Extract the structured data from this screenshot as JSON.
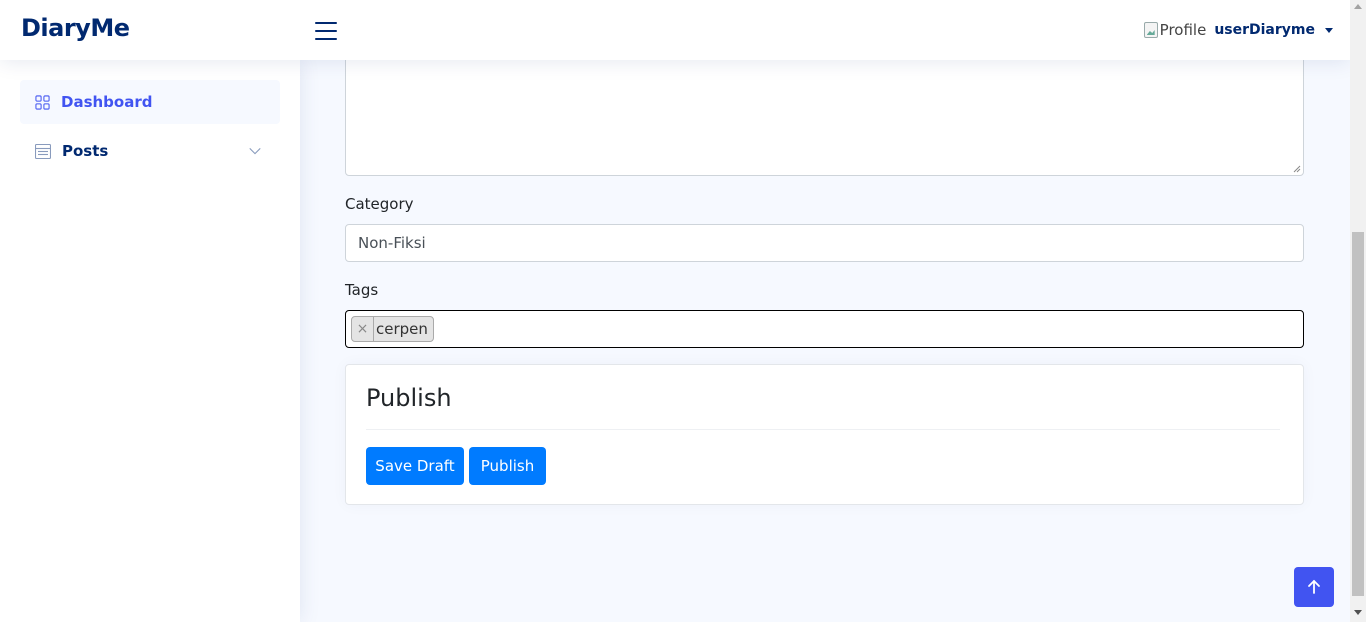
{
  "header": {
    "logo": "DiaryMe",
    "profile_img_alt": "Profile",
    "username": "userDiaryme"
  },
  "sidebar": {
    "items": [
      {
        "label": "Dashboard",
        "icon": "grid-icon",
        "active": true
      },
      {
        "label": "Posts",
        "icon": "layout-text-icon",
        "active": false
      }
    ]
  },
  "form": {
    "category_label": "Category",
    "category_value": "Non-Fiksi",
    "tags_label": "Tags",
    "tags": [
      "cerpen"
    ],
    "tag_remove": "×"
  },
  "publish_card": {
    "title": "Publish",
    "save_draft_label": "Save Draft",
    "publish_label": "Publish"
  },
  "colors": {
    "brand": "#012970",
    "accent": "#4154f1",
    "button": "#007bff"
  }
}
